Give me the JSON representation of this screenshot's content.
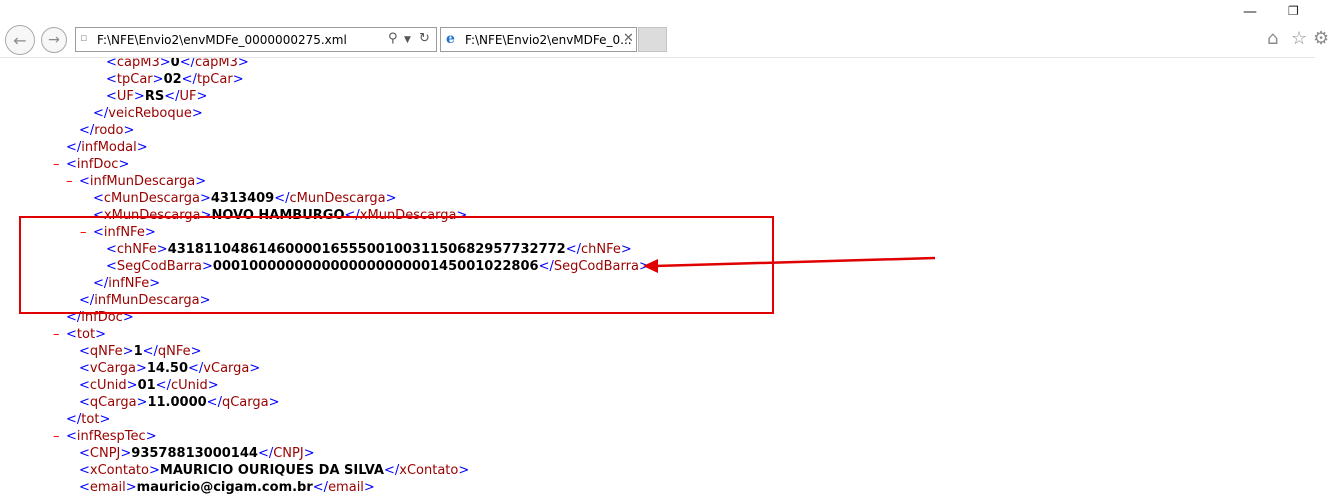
{
  "browser": {
    "address": "F:\\NFE\\Envio2\\envMDFe_0000000275.xml",
    "tab_title": "F:\\NFE\\Envio2\\envMDFe_0...",
    "icons": {
      "back": "back-arrow-icon",
      "forward": "forward-arrow-icon",
      "search": "search-icon",
      "dropdown": "chevron-down-icon",
      "refresh": "refresh-icon",
      "ie": "ie-logo-icon",
      "close_tab": "close-icon",
      "home": "home-icon",
      "favorites": "star-icon",
      "settings": "gear-icon",
      "minimize": "minimize-icon",
      "restore": "restore-icon"
    }
  },
  "xml_lines": [
    {
      "type": "element",
      "indent": 0,
      "tag": "capM3",
      "value": "0"
    },
    {
      "type": "element",
      "indent": 0,
      "tag": "tpCar",
      "value": "02"
    },
    {
      "type": "element",
      "indent": 0,
      "tag": "UF",
      "value": "RS"
    },
    {
      "type": "close",
      "indent": 1,
      "tag": "veicReboque"
    },
    {
      "type": "close",
      "indent": 2,
      "tag": "rodo"
    },
    {
      "type": "close",
      "indent": 3,
      "tag": "infModal"
    },
    {
      "type": "open",
      "indent": 3,
      "tag": "infDoc",
      "collapsible": true
    },
    {
      "type": "open",
      "indent": 2,
      "tag": "infMunDescarga",
      "collapsible": true
    },
    {
      "type": "element",
      "indent": 1,
      "tag": "cMunDescarga",
      "value": "4313409"
    },
    {
      "type": "element",
      "indent": 1,
      "tag": "xMunDescarga",
      "value": "NOVO HAMBURGO"
    },
    {
      "type": "open",
      "indent": 1,
      "tag": "infNFe",
      "collapsible": true
    },
    {
      "type": "element",
      "indent": 0,
      "tag": "chNFe",
      "value": "43181104861460000165550010031150682957732772"
    },
    {
      "type": "element",
      "indent": 0,
      "tag": "SegCodBarra",
      "value": "000100000000000000000000145001022806"
    },
    {
      "type": "close",
      "indent": 1,
      "tag": "infNFe"
    },
    {
      "type": "close",
      "indent": 2,
      "tag": "infMunDescarga"
    },
    {
      "type": "close",
      "indent": 3,
      "tag": "infDoc"
    },
    {
      "type": "open",
      "indent": 3,
      "tag": "tot",
      "collapsible": true
    },
    {
      "type": "element",
      "indent": 2,
      "tag": "qNFe",
      "value": "1"
    },
    {
      "type": "element",
      "indent": 2,
      "tag": "vCarga",
      "value": "14.50"
    },
    {
      "type": "element",
      "indent": 2,
      "tag": "cUnid",
      "value": "01"
    },
    {
      "type": "element",
      "indent": 2,
      "tag": "qCarga",
      "value": "11.0000"
    },
    {
      "type": "close",
      "indent": 3,
      "tag": "tot"
    },
    {
      "type": "open",
      "indent": 3,
      "tag": "infRespTec",
      "collapsible": true
    },
    {
      "type": "element",
      "indent": 2,
      "tag": "CNPJ",
      "value": "93578813000144"
    },
    {
      "type": "element",
      "indent": 2,
      "tag": "xContato",
      "value": "MAURICIO OURIQUES DA SILVA"
    },
    {
      "type": "element",
      "indent": 2,
      "tag": "email",
      "value": "mauricio@cigam.com.br"
    }
  ],
  "annotation": {
    "highlight_color": "#e00000",
    "arrow_color": "#e00000"
  }
}
